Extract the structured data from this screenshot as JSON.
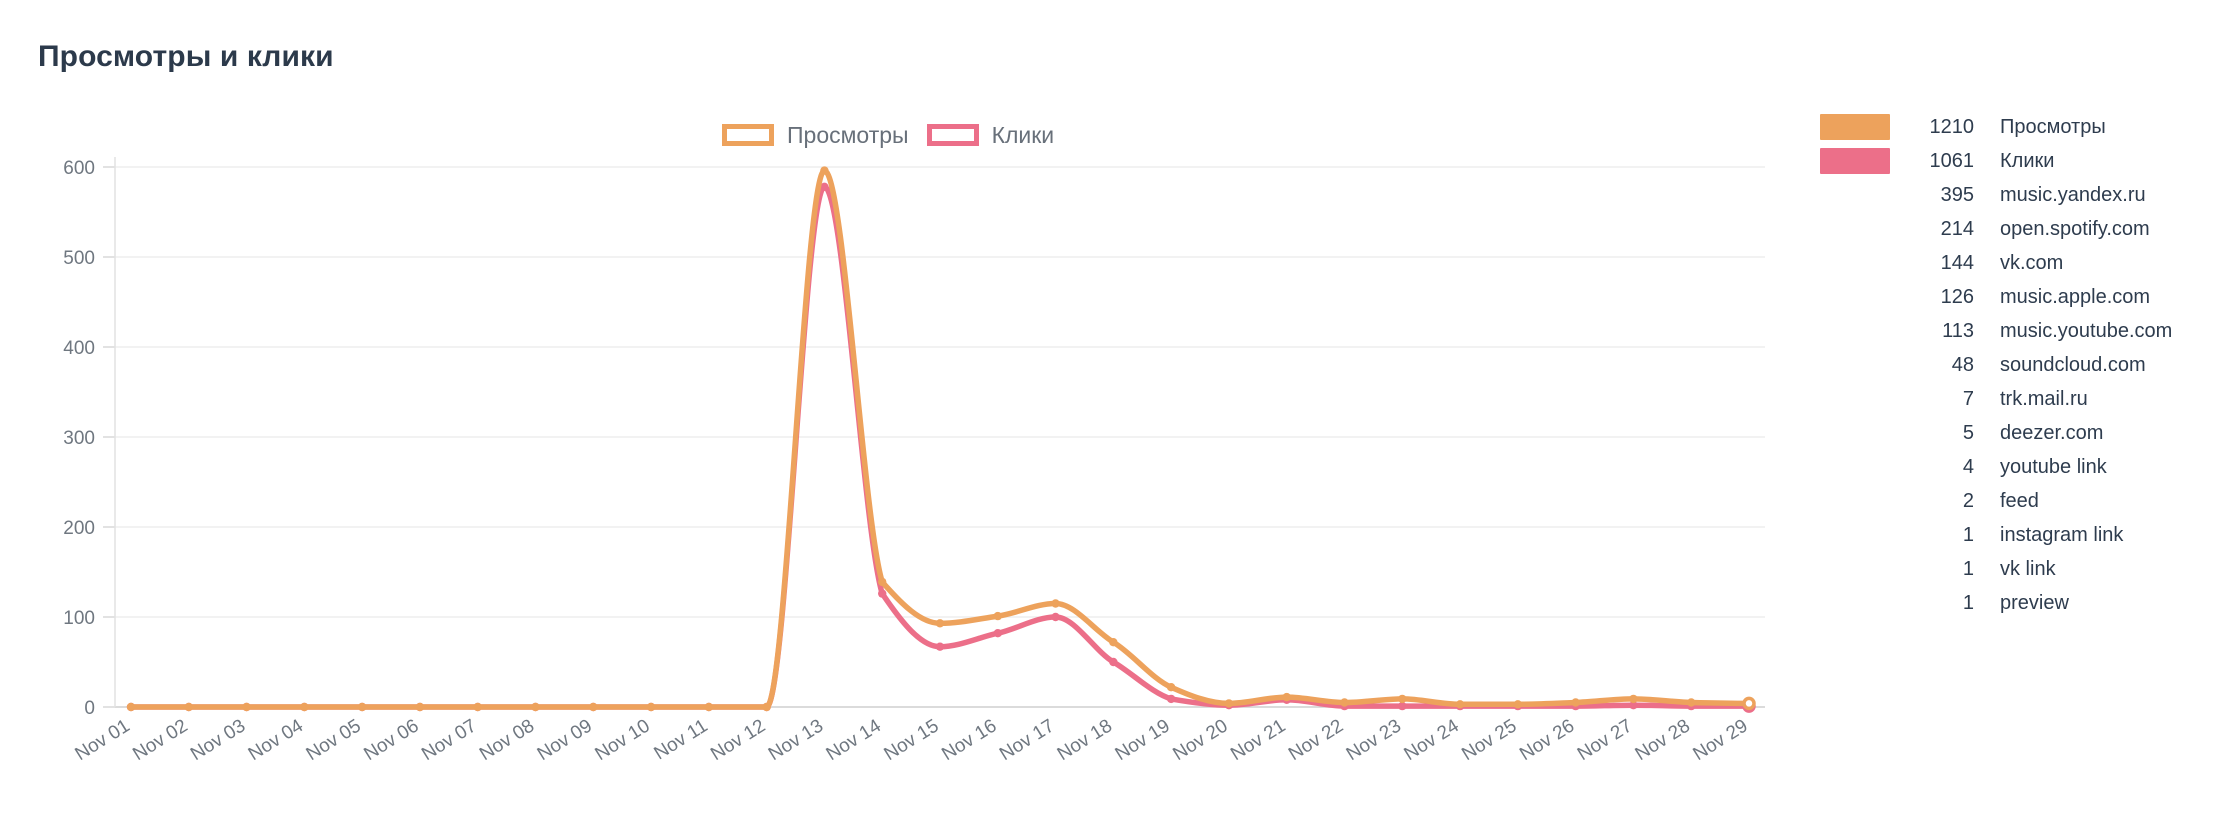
{
  "page": {
    "title": "Просмотры и клики",
    "background": "#ffffff"
  },
  "colors": {
    "views": "#eda25c",
    "clicks": "#ec6f89",
    "text": "#2e3c4e",
    "axis_text": "#6f7780",
    "grid": "#ededed"
  },
  "inline_legend": {
    "items": [
      {
        "label": "Просмотры",
        "color": "#eda25c",
        "style": "outline"
      },
      {
        "label": "Клики",
        "color": "#ec6f89",
        "style": "outline"
      }
    ]
  },
  "side_legend": {
    "rows": [
      {
        "value": "1210",
        "name": "Просмотры",
        "color": "#eda25c",
        "has_swatch": true
      },
      {
        "value": "1061",
        "name": "Клики",
        "color": "#ec6f89",
        "has_swatch": true
      },
      {
        "value": "395",
        "name": "music.yandex.ru",
        "color": "",
        "has_swatch": false
      },
      {
        "value": "214",
        "name": "open.spotify.com",
        "color": "",
        "has_swatch": false
      },
      {
        "value": "144",
        "name": "vk.com",
        "color": "",
        "has_swatch": false
      },
      {
        "value": "126",
        "name": "music.apple.com",
        "color": "",
        "has_swatch": false
      },
      {
        "value": "113",
        "name": "music.youtube.com",
        "color": "",
        "has_swatch": false
      },
      {
        "value": "48",
        "name": "soundcloud.com",
        "color": "",
        "has_swatch": false
      },
      {
        "value": "7",
        "name": "trk.mail.ru",
        "color": "",
        "has_swatch": false
      },
      {
        "value": "5",
        "name": "deezer.com",
        "color": "",
        "has_swatch": false
      },
      {
        "value": "4",
        "name": "youtube link",
        "color": "",
        "has_swatch": false
      },
      {
        "value": "2",
        "name": "feed",
        "color": "",
        "has_swatch": false
      },
      {
        "value": "1",
        "name": "instagram link",
        "color": "",
        "has_swatch": false
      },
      {
        "value": "1",
        "name": "vk link",
        "color": "",
        "has_swatch": false
      },
      {
        "value": "1",
        "name": "preview",
        "color": "",
        "has_swatch": false
      }
    ]
  },
  "chart_data": {
    "type": "line",
    "title": "Просмотры и клики",
    "xlabel": "",
    "ylabel": "",
    "ylim": [
      0,
      600
    ],
    "yticks": [
      0,
      100,
      200,
      300,
      400,
      500,
      600
    ],
    "grid": true,
    "legend_position": "top-center",
    "smooth": true,
    "categories": [
      "Nov 01",
      "Nov 02",
      "Nov 03",
      "Nov 04",
      "Nov 05",
      "Nov 06",
      "Nov 07",
      "Nov 08",
      "Nov 09",
      "Nov 10",
      "Nov 11",
      "Nov 12",
      "Nov 13",
      "Nov 14",
      "Nov 15",
      "Nov 16",
      "Nov 17",
      "Nov 18",
      "Nov 19",
      "Nov 20",
      "Nov 21",
      "Nov 22",
      "Nov 23",
      "Nov 24",
      "Nov 25",
      "Nov 26",
      "Nov 27",
      "Nov 28",
      "Nov 29"
    ],
    "series": [
      {
        "name": "Просмотры",
        "color": "#eda25c",
        "total": 1210,
        "values": [
          0,
          0,
          0,
          0,
          0,
          0,
          0,
          0,
          0,
          0,
          0,
          0,
          596,
          139,
          93,
          101,
          115,
          72,
          22,
          4,
          11,
          5,
          9,
          3,
          3,
          5,
          9,
          5,
          4
        ]
      },
      {
        "name": "Клики",
        "color": "#ec6f89",
        "total": 1061,
        "values": [
          0,
          0,
          0,
          0,
          0,
          0,
          0,
          0,
          0,
          0,
          0,
          0,
          578,
          126,
          67,
          82,
          100,
          50,
          9,
          2,
          8,
          1,
          1,
          1,
          1,
          1,
          2,
          1,
          1
        ]
      }
    ]
  }
}
